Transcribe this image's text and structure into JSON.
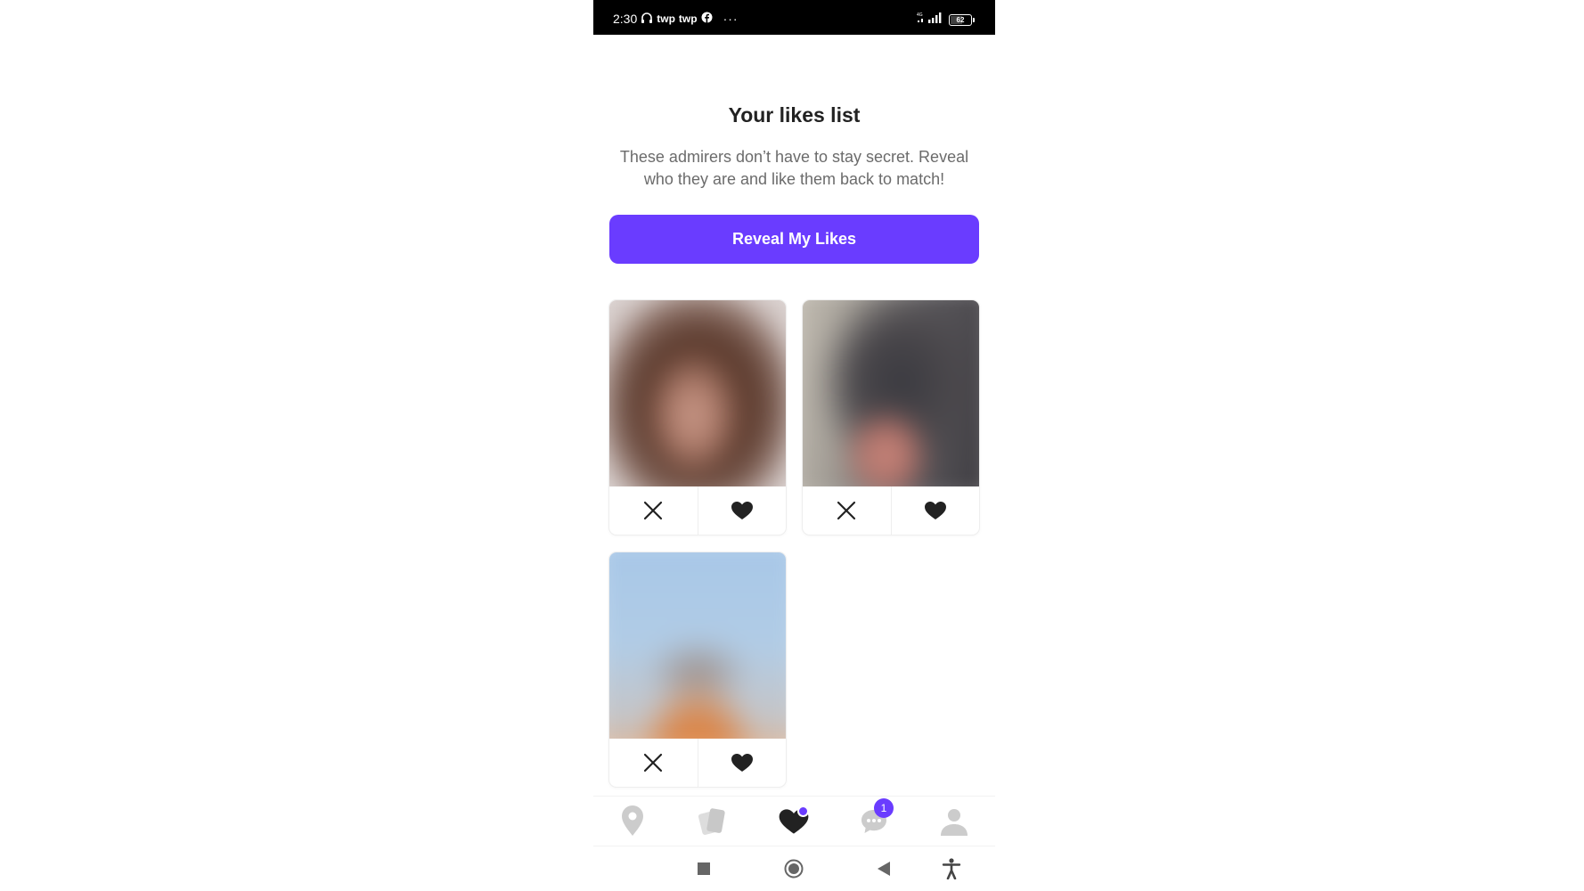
{
  "status_bar": {
    "time": "2:30",
    "app_icons": [
      "headset-icon",
      "twp-icon",
      "twp-icon",
      "facebook-icon"
    ],
    "app_labels": [
      "twp",
      "twp"
    ],
    "more": "···",
    "network": "4G",
    "battery": "62",
    "battery_level": 0.62
  },
  "page": {
    "title": "Your likes list",
    "subtitle": "These admirers don’t have to stay secret. Reveal who they are and like them back to match!",
    "reveal_button": "Reveal My Likes"
  },
  "cards": [
    {
      "photo": "blurred-profile-photo",
      "actions": [
        "close-icon",
        "heart-icon"
      ]
    },
    {
      "photo": "blurred-profile-photo",
      "actions": [
        "close-icon",
        "heart-icon"
      ]
    },
    {
      "photo": "blurred-profile-photo",
      "actions": [
        "close-icon",
        "heart-icon"
      ]
    }
  ],
  "bottom_nav": {
    "items": [
      {
        "name": "location-pin-icon",
        "active": false
      },
      {
        "name": "cards-icon",
        "active": false
      },
      {
        "name": "heart-icon",
        "active": true,
        "dot": true
      },
      {
        "name": "chat-icon",
        "active": false,
        "badge": "1"
      },
      {
        "name": "profile-icon",
        "active": false
      }
    ]
  },
  "android_nav": {
    "items": [
      "recents-icon",
      "home-icon",
      "back-icon",
      "accessibility-icon"
    ]
  },
  "colors": {
    "accent": "#6a3cff",
    "title": "#222222",
    "subtitle": "#6b6b6b",
    "icon_inactive": "#cccccc",
    "icon_active": "#222222",
    "status_bar": "#000000"
  }
}
